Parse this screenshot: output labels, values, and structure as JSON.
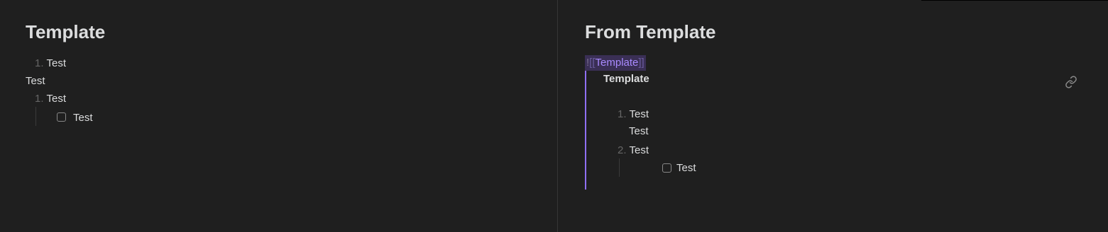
{
  "left_note": {
    "title": "Template",
    "list1": {
      "number": "1.",
      "text": "Test"
    },
    "paragraph": "Test",
    "list2": {
      "number": "1.",
      "text": "Test"
    },
    "task": {
      "text": "Test",
      "checked": false
    }
  },
  "right_note": {
    "title": "From Template",
    "embed": {
      "prefix": "!",
      "open_brackets": "[[",
      "target": "Template",
      "close_brackets": "]]",
      "title": "Template",
      "link_icon": "link-icon",
      "list1": {
        "number": "1.",
        "text": "Test"
      },
      "paragraph": "Test",
      "list2": {
        "number": "2.",
        "text": "Test"
      },
      "task": {
        "text": "Test",
        "checked": false
      }
    }
  },
  "colors": {
    "background": "#1f1f1f",
    "text": "#dcddde",
    "accent": "#8f6ff3",
    "link": "#a98aff",
    "muted": "#666666"
  }
}
